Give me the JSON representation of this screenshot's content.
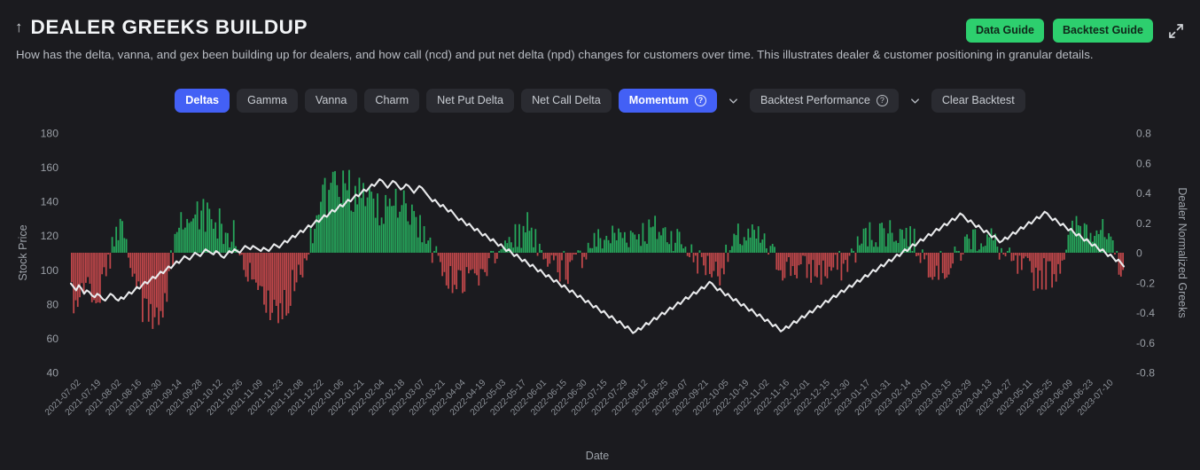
{
  "header": {
    "up_arrow_icon": "arrow-up-icon",
    "title": "DEALER GREEKS BUILDUP",
    "subtitle": "How has the delta, vanna, and gex been building up for dealers, and how call (ncd) and put net delta (npd) changes for customers over time. This illustrates dealer & customer positioning in granular details.",
    "data_guide_label": "Data Guide",
    "backtest_guide_label": "Backtest Guide",
    "expand_icon": "expand-diagonal-icon",
    "accent_green": "#2dcf6e"
  },
  "toolbar": {
    "accent_blue": "#4360f5",
    "greek_tabs": [
      {
        "label": "Deltas",
        "active": true
      },
      {
        "label": "Gamma",
        "active": false
      },
      {
        "label": "Vanna",
        "active": false
      },
      {
        "label": "Charm",
        "active": false
      },
      {
        "label": "Net Put Delta",
        "active": false
      },
      {
        "label": "Net Call Delta",
        "active": false
      }
    ],
    "momentum_select": {
      "label": "Momentum",
      "help_icon": "question-circle-icon",
      "chevron_icon": "chevron-down-icon",
      "active": true
    },
    "backtest_select": {
      "label": "Backtest Performance",
      "help_icon": "question-circle-icon",
      "chevron_icon": "chevron-down-icon",
      "active": false
    },
    "clear_backtest_label": "Clear Backtest"
  },
  "chart_data": {
    "type": "bar",
    "title": "DEALER GREEKS BUILDUP",
    "xlabel": "Date",
    "ylabel": "Stock Price",
    "y2label": "Dealer Normalized Greeks",
    "grid": false,
    "legend": "none",
    "ylim": [
      40,
      180
    ],
    "yticks": [
      40,
      60,
      80,
      100,
      120,
      140,
      160,
      180
    ],
    "y2lim": [
      -0.8,
      0.8
    ],
    "y2ticks": [
      -0.8,
      -0.6,
      -0.4,
      -0.2,
      0,
      0.2,
      0.4,
      0.6,
      0.8
    ],
    "colors": {
      "positive_bar": "#26a65b",
      "negative_bar": "#c0474a",
      "line": "#e9eaec",
      "background": "#1b1b1f"
    },
    "xtick_labels": [
      "2021-07-02",
      "2021-07-19",
      "2021-08-02",
      "2021-08-16",
      "2021-08-30",
      "2021-09-14",
      "2021-09-28",
      "2021-10-12",
      "2021-10-26",
      "2021-11-09",
      "2021-11-23",
      "2021-12-08",
      "2021-12-22",
      "2022-01-06",
      "2022-01-21",
      "2022-02-04",
      "2022-02-18",
      "2022-03-07",
      "2022-03-21",
      "2022-04-04",
      "2022-04-19",
      "2022-05-03",
      "2022-05-17",
      "2022-06-01",
      "2022-06-15",
      "2022-06-30",
      "2022-07-15",
      "2022-07-29",
      "2022-08-12",
      "2022-08-25",
      "2022-09-07",
      "2022-09-21",
      "2022-10-05",
      "2022-10-19",
      "2022-11-02",
      "2022-11-16",
      "2022-12-01",
      "2022-12-15",
      "2022-12-30",
      "2023-01-17",
      "2023-01-31",
      "2023-02-14",
      "2023-03-01",
      "2023-03-15",
      "2023-03-29",
      "2023-04-13",
      "2023-04-27",
      "2023-05-11",
      "2023-05-25",
      "2023-06-09",
      "2023-06-23",
      "2023-07-10"
    ],
    "series": [
      {
        "name": "Stock Price",
        "type": "line",
        "axis": "left",
        "color": "#e9eaec",
        "values": [
          92,
          90,
          88,
          91,
          89,
          86,
          88,
          87,
          85,
          84,
          86,
          85,
          83,
          82,
          84,
          86,
          85,
          83,
          82,
          84,
          83,
          85,
          87,
          86,
          88,
          90,
          89,
          91,
          93,
          92,
          94,
          96,
          95,
          97,
          99,
          98,
          100,
          102,
          101,
          103,
          105,
          104,
          106,
          108,
          107,
          106,
          108,
          110,
          109,
          108,
          110,
          112,
          111,
          110,
          109,
          111,
          110,
          108,
          107,
          109,
          111,
          110,
          112,
          111,
          110,
          112,
          114,
          113,
          112,
          114,
          113,
          112,
          111,
          113,
          112,
          111,
          113,
          115,
          114,
          113,
          115,
          117,
          116,
          118,
          120,
          119,
          121,
          123,
          122,
          124,
          126,
          125,
          127,
          129,
          128,
          130,
          132,
          131,
          133,
          135,
          134,
          136,
          138,
          137,
          139,
          141,
          140,
          142,
          144,
          143,
          145,
          147,
          146,
          148,
          150,
          149,
          151,
          153,
          152,
          150,
          148,
          150,
          152,
          151,
          149,
          147,
          148,
          150,
          149,
          147,
          145,
          147,
          149,
          148,
          146,
          144,
          142,
          140,
          141,
          139,
          137,
          138,
          136,
          134,
          135,
          133,
          131,
          129,
          130,
          128,
          126,
          127,
          125,
          123,
          124,
          122,
          120,
          121,
          119,
          117,
          118,
          116,
          114,
          115,
          113,
          111,
          112,
          110,
          108,
          109,
          107,
          105,
          106,
          104,
          102,
          103,
          101,
          99,
          100,
          98,
          96,
          97,
          95,
          93,
          94,
          92,
          90,
          91,
          89,
          87,
          88,
          86,
          84,
          85,
          83,
          81,
          82,
          80,
          78,
          79,
          77,
          75,
          76,
          74,
          72,
          73,
          71,
          69,
          70,
          68,
          66,
          67,
          65,
          63,
          64,
          66,
          65,
          67,
          69,
          68,
          70,
          72,
          71,
          73,
          75,
          74,
          76,
          78,
          77,
          79,
          81,
          80,
          82,
          84,
          83,
          85,
          87,
          86,
          88,
          90,
          89,
          91,
          93,
          92,
          90,
          88,
          89,
          87,
          85,
          86,
          84,
          82,
          83,
          81,
          79,
          80,
          78,
          76,
          77,
          75,
          73,
          74,
          72,
          70,
          71,
          69,
          67,
          68,
          66,
          64,
          65,
          67,
          66,
          68,
          70,
          69,
          71,
          73,
          72,
          74,
          76,
          75,
          77,
          79,
          78,
          80,
          82,
          81,
          83,
          85,
          84,
          86,
          88,
          87,
          89,
          91,
          90,
          92,
          94,
          93,
          95,
          97,
          96,
          98,
          100,
          99,
          101,
          103,
          102,
          104,
          106,
          105,
          107,
          109,
          108,
          110,
          112,
          111,
          113,
          115,
          114,
          116,
          118,
          117,
          119,
          121,
          120,
          122,
          124,
          123,
          125,
          127,
          126,
          128,
          130,
          129,
          131,
          133,
          132,
          130,
          128,
          129,
          127,
          125,
          126,
          124,
          122,
          123,
          121,
          119,
          120,
          118,
          116,
          117,
          119,
          118,
          120,
          122,
          121,
          123,
          125,
          124,
          126,
          128,
          127,
          129,
          131,
          130,
          132,
          134,
          133,
          131,
          129,
          130,
          128,
          126,
          127,
          125,
          123,
          124,
          122,
          120,
          121,
          119,
          117,
          118,
          116,
          114,
          115,
          113,
          111,
          112,
          110,
          108,
          109,
          107,
          105,
          106,
          104,
          102
        ]
      },
      {
        "name": "Dealer Normalized Greeks",
        "type": "bar",
        "axis": "right",
        "positive_color": "#26a65b",
        "negative_color": "#c0474a",
        "note": "Daily bars; positive (green) above zero, negative (red) below zero. Zero line maps to 0 on the right axis (~105 on left axis)."
      }
    ],
    "summary": {
      "date_range": [
        "2021-07-02",
        "2023-07-10"
      ],
      "stock_price_min_approx": 60,
      "stock_price_max_approx": 170,
      "greeks_min_approx": -0.62,
      "greeks_max_approx": 0.55
    }
  }
}
